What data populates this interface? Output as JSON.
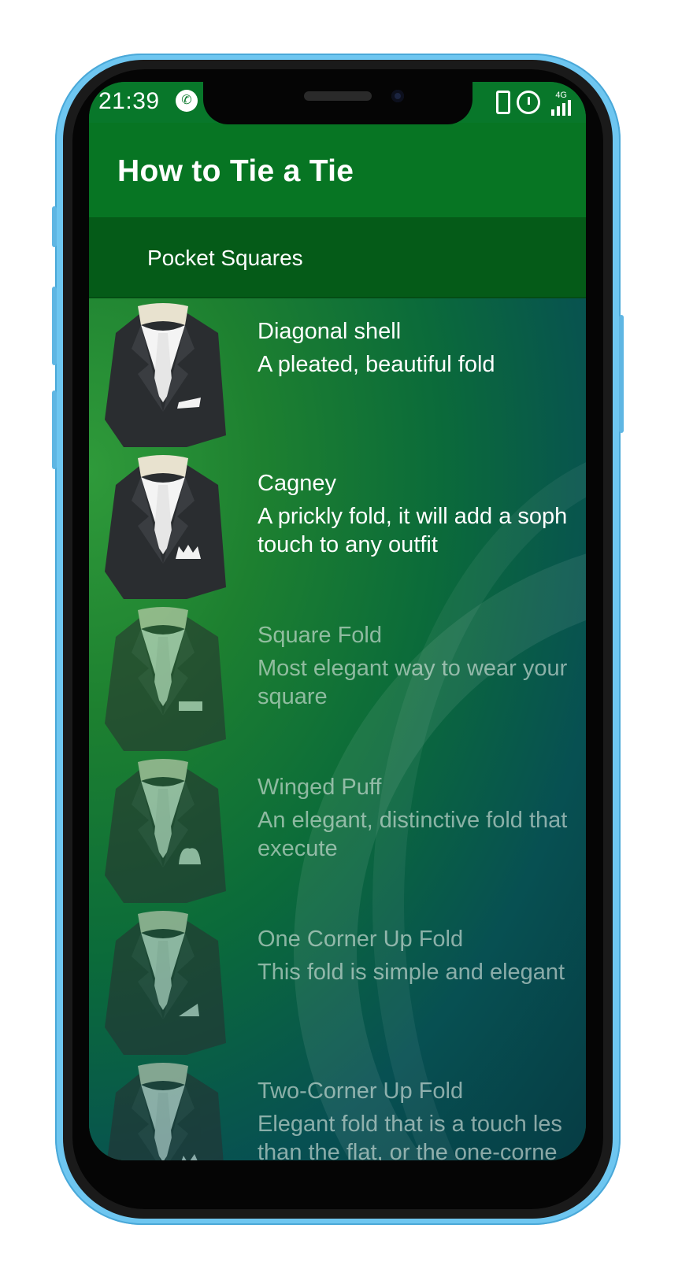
{
  "status_bar": {
    "time": "21:39",
    "network": "4G"
  },
  "app_bar": {
    "title": "How to Tie a Tie"
  },
  "tabs": [
    {
      "label": "Pocket Squares"
    }
  ],
  "items": [
    {
      "title": "Diagonal shell",
      "desc_lines": [
        "A pleated, beautiful fold"
      ],
      "fold": "diagonal",
      "dimmed": false
    },
    {
      "title": "Cagney",
      "desc_lines": [
        "A prickly fold, it will add a soph",
        "touch to any outfit"
      ],
      "fold": "crown",
      "dimmed": false
    },
    {
      "title": "Square Fold",
      "desc_lines": [
        "Most elegant way to wear your",
        "square"
      ],
      "fold": "square",
      "dimmed": true
    },
    {
      "title": "Winged Puff",
      "desc_lines": [
        "An elegant, distinctive fold that",
        "execute"
      ],
      "fold": "puff",
      "dimmed": true
    },
    {
      "title": "One Corner Up Fold",
      "desc_lines": [
        "This fold is simple and elegant"
      ],
      "fold": "onecorner",
      "dimmed": true
    },
    {
      "title": "Two-Corner Up Fold",
      "desc_lines": [
        "Elegant fold that is a touch les",
        "than the flat, or the one-corne"
      ],
      "fold": "twocorner",
      "dimmed": true
    }
  ],
  "colors": {
    "status_bar": "#08772a",
    "app_bar": "#077523",
    "tab_bar": "#055b18",
    "phone_frame": "#6ec6f0"
  }
}
